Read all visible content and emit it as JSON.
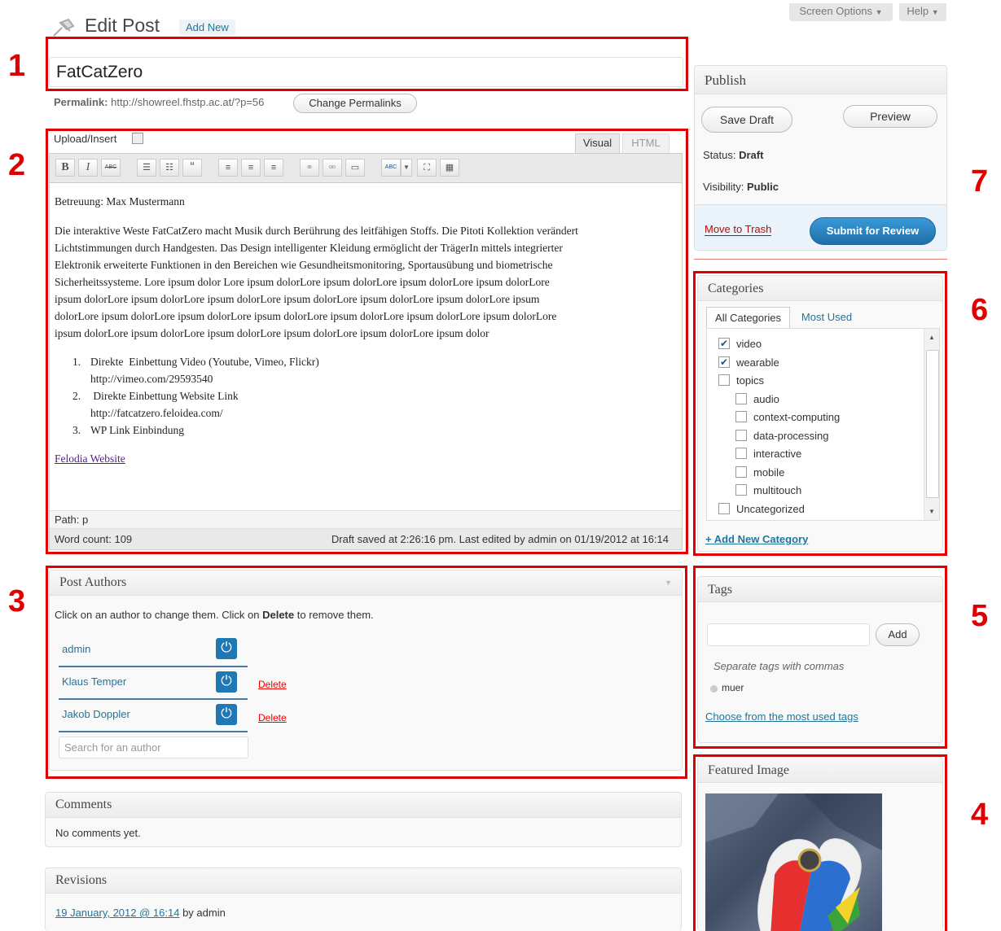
{
  "header": {
    "title": "Edit Post",
    "add_new": "Add New",
    "screen_options": "Screen Options",
    "help": "Help"
  },
  "post": {
    "title": "FatCatZero",
    "permalink_label": "Permalink:",
    "permalink_url": "http://showreel.fhstp.ac.at/?p=56",
    "change_permalinks": "Change Permalinks"
  },
  "editor": {
    "upload_insert": "Upload/Insert",
    "tab_visual": "Visual",
    "tab_html": "HTML",
    "toolbar": {
      "bold": "B",
      "italic": "I",
      "strike": "ABC",
      "quote": "“",
      "spell": "ABC"
    },
    "content": {
      "line1": "Betreuung: Max Mustermann",
      "para": [
        "Die interaktive Weste FatCatZero macht Musik durch Berührung des leitfähigen Stoffs. Die Pitoti Kollektion verändert",
        "Lichtstimmungen durch Handgesten. Das Design intelligenter Kleidung ermöglicht der TrägerIn mittels integrierter",
        "Elektronik erweiterte Funktionen in den Bereichen wie Gesundheitsmonitoring, Sportausübung und biometrische",
        "Sicherheitssysteme. Lore ipsum dolor Lore ipsum dolorLore ipsum dolorLore ipsum dolorLore ipsum dolorLore",
        "ipsum dolorLore ipsum dolorLore ipsum dolorLore ipsum dolorLore ipsum dolorLore ipsum dolorLore ipsum",
        "dolorLore ipsum dolorLore ipsum dolorLore ipsum dolorLore ipsum dolorLore ipsum dolorLore ipsum dolorLore",
        "ipsum dolorLore ipsum dolorLore ipsum dolorLore ipsum dolorLore ipsum dolorLore ipsum dolor"
      ],
      "list": [
        {
          "n": "1.",
          "line1": "Direkte  Einbettung Video (Youtube, Vimeo, Flickr)",
          "line2": "http://vimeo.com/29593540"
        },
        {
          "n": "2.",
          "line1": " Direkte Einbettung Website Link",
          "line2": "http://fatcatzero.feloidea.com/"
        },
        {
          "n": "3.",
          "line1": "WP Link Einbindung",
          "line2": ""
        }
      ],
      "link": "Felodia Website"
    },
    "path": "Path: p",
    "word_count": "Word count: 109",
    "draft_saved": "Draft saved at 2:26:16 pm. Last edited by admin on 01/19/2012 at 16:14"
  },
  "authors": {
    "title": "Post Authors",
    "help_pre": "Click on an author to change them. Click on ",
    "help_bold": "Delete",
    "help_post": " to remove them.",
    "list": [
      "admin",
      "Klaus Temper",
      "Jakob Doppler"
    ],
    "delete": "Delete",
    "search_placeholder": "Search for an author"
  },
  "comments": {
    "title": "Comments",
    "text": "No comments yet."
  },
  "revisions": {
    "title": "Revisions",
    "link": "19 January, 2012 @ 16:14",
    "by": " by admin"
  },
  "publish": {
    "title": "Publish",
    "save_draft": "Save Draft",
    "preview": "Preview",
    "status_label": "Status:",
    "status_value": "Draft",
    "visibility_label": "Visibility:",
    "visibility_value": "Public",
    "trash": "Move to Trash",
    "submit": "Submit for Review"
  },
  "categories": {
    "title": "Categories",
    "tab_all": "All Categories",
    "tab_most": "Most Used",
    "items": [
      {
        "label": "video",
        "checked": true,
        "level": 0
      },
      {
        "label": "wearable",
        "checked": true,
        "level": 0
      },
      {
        "label": "topics",
        "checked": false,
        "level": 0
      },
      {
        "label": "audio",
        "checked": false,
        "level": 1
      },
      {
        "label": "context-computing",
        "checked": false,
        "level": 1
      },
      {
        "label": "data-processing",
        "checked": false,
        "level": 1
      },
      {
        "label": "interactive",
        "checked": false,
        "level": 1
      },
      {
        "label": "mobile",
        "checked": false,
        "level": 1
      },
      {
        "label": "multitouch",
        "checked": false,
        "level": 1
      },
      {
        "label": "Uncategorized",
        "checked": false,
        "level": 0
      }
    ],
    "add_new": "+ Add New Category"
  },
  "tags": {
    "title": "Tags",
    "add": "Add",
    "hint": "Separate tags with commas",
    "tag": "muer",
    "choose": "Choose from the most used tags"
  },
  "featured": {
    "title": "Featured Image"
  },
  "annotations": [
    "1",
    "2",
    "3",
    "4",
    "5",
    "6",
    "7"
  ],
  "colors": {
    "annotation": "#e10000",
    "link": "#21759b",
    "submit": "#2e8bcc",
    "trash": "#bc0b0b"
  }
}
